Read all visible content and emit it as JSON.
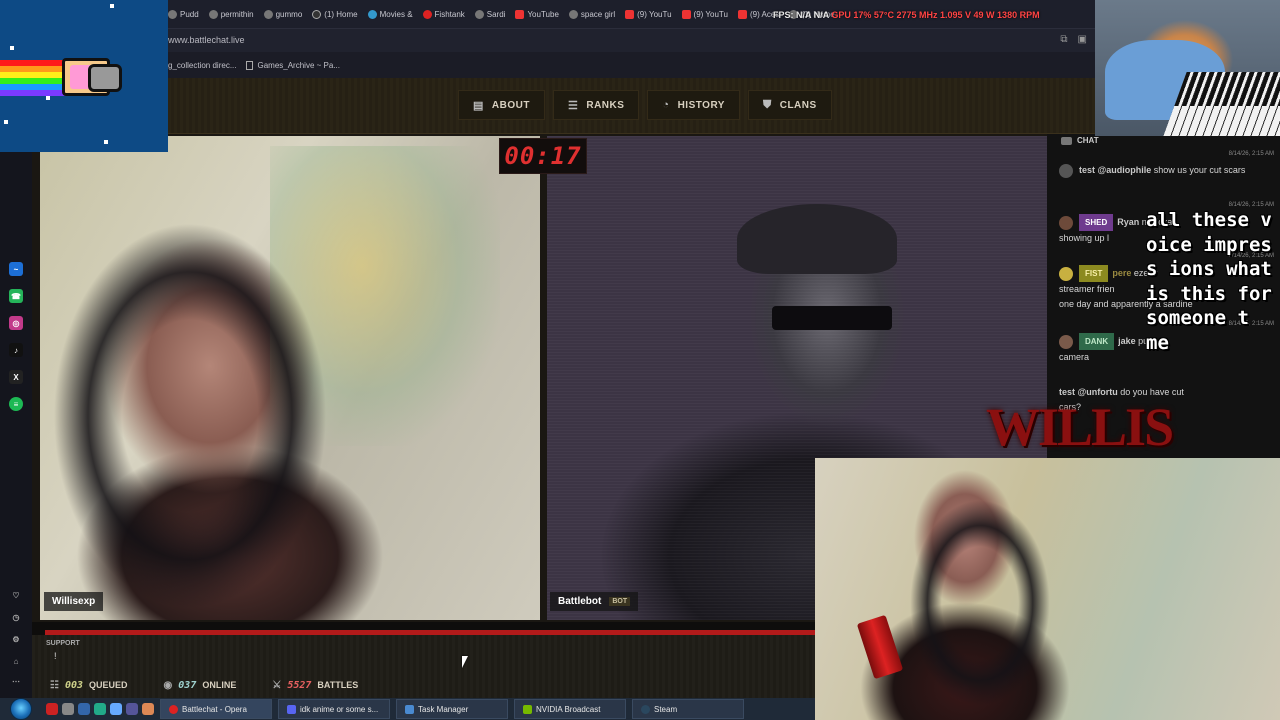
{
  "browser": {
    "tabs": [
      "Pudd",
      "permithin",
      "gummo",
      "(1) Home",
      "Movies &",
      "Fishtank",
      "Sardi",
      "YouTube",
      "space girl",
      "(9) YouTu",
      "(9) YouTu",
      "(9) Aces",
      "(1) Home"
    ],
    "url": "www.battlechat.live",
    "bookmarks": [
      "g_collection direc...",
      "Games_Archive ~ Pa..."
    ]
  },
  "perf_overlay": {
    "fps": "FPS: N/A",
    "na": "N/A",
    "stats": "GPU 17% 57°C 2775 MHz 1.095 V 49 W 1380 RPM"
  },
  "site": {
    "nav": [
      {
        "label": "ABOUT",
        "icon": "book-icon"
      },
      {
        "label": "RANKS",
        "icon": "rank-icon"
      },
      {
        "label": "HISTORY",
        "icon": "clock-icon"
      },
      {
        "label": "CLANS",
        "icon": "shield-icon"
      }
    ]
  },
  "battle": {
    "timer": "00:17",
    "left_name": "Willisexp",
    "right_name": "Battlebot",
    "bot_badge": "BOT",
    "progress": 1.0
  },
  "support": {
    "label": "SUPPORT",
    "icon_text": "!"
  },
  "stats": {
    "queued": {
      "value": "003",
      "label": "QUEUED"
    },
    "online": {
      "value": "037",
      "label": "ONLINE"
    },
    "battles": {
      "value": "5527",
      "label": "BATTLES"
    }
  },
  "chat": {
    "header": "CHAT",
    "messages": [
      {
        "rank": "",
        "user": "test @audiophile",
        "text": "show us your cut scars",
        "ts": "8/14/26, 2:15 AM"
      },
      {
        "rank": "SHED",
        "user": "Ryan",
        "text": "showing up l",
        "extra": "ne lickas",
        "ts": "8/14/26, 2:15 AM"
      },
      {
        "rank": "FIST",
        "user": "pere",
        "text": "streamer frien",
        "text2": "one day and apparently a sardine",
        "extra": "ezens",
        "ts": "8/14/26, 2:15 AM"
      },
      {
        "rank": "DANK",
        "user": "jake",
        "text": "camera",
        "extra": "puke",
        "ts": "8/14/26, 2:15 AM"
      },
      {
        "rank": "",
        "user": "test @unfortu",
        "text": "cars?",
        "extra": "do you have cut",
        "ts": ""
      }
    ]
  },
  "overlay": {
    "tts_text": "all these voice impress ions what is this for someone t  me",
    "logo": "WILLIS"
  },
  "taskbar": {
    "items": [
      "Battlechat - Opera",
      "idk anime or some s...",
      "Task Manager",
      "NVIDIA Broadcast",
      "Steam"
    ]
  },
  "colors": {
    "accent_red": "#b21a1a",
    "timer_red": "#e03030"
  }
}
